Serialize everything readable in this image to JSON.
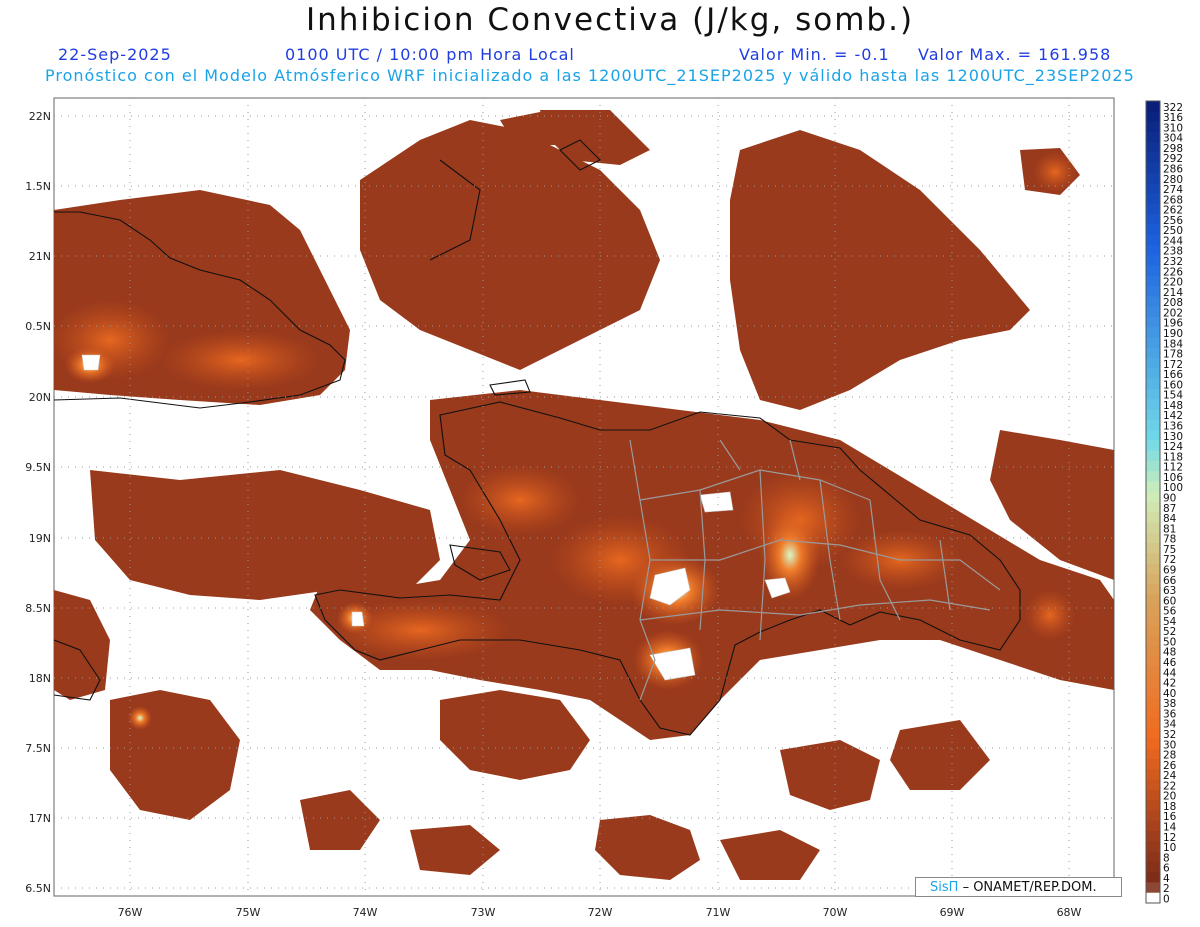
{
  "header": {
    "title": "Inhibicion Convectiva (J/kg, somb.)",
    "date": "22-Sep-2025",
    "time": "0100 UTC / 10:00 pm Hora Local",
    "min_label": "Valor Min. = -0.1",
    "max_label": "Valor Max. = 161.958",
    "forecast_line": "Pronóstico con el Modelo Atmósferico WRF inicializado a las 1200UTC_21SEP2025 y válido hasta las  1200UTC_23SEP2025"
  },
  "credit": {
    "logo_text": "SisΠ",
    "org_text": "– ONAMET/REP.DOM."
  },
  "map": {
    "lat_ticks": [
      "22N",
      "1.5N",
      "21N",
      "0.5N",
      "20N",
      "9.5N",
      "19N",
      "8.5N",
      "18N",
      "7.5N",
      "17N",
      "6.5N"
    ],
    "lon_ticks": [
      "76W",
      "75W",
      "74W",
      "73W",
      "72W",
      "71W",
      "70W",
      "69W",
      "68W"
    ],
    "regions": [
      "Cuba (oriente)",
      "Haití",
      "República Dominicana",
      "Jamaica",
      "Bahamas / Turks y Caicos"
    ]
  },
  "colorbar": {
    "labels": [
      "322",
      "316",
      "310",
      "304",
      "298",
      "292",
      "286",
      "280",
      "274",
      "268",
      "262",
      "256",
      "250",
      "244",
      "238",
      "232",
      "226",
      "220",
      "214",
      "208",
      "202",
      "196",
      "190",
      "184",
      "178",
      "172",
      "166",
      "160",
      "154",
      "148",
      "142",
      "136",
      "130",
      "124",
      "118",
      "112",
      "106",
      "100",
      "90",
      "87",
      "84",
      "81",
      "78",
      "75",
      "72",
      "69",
      "66",
      "63",
      "60",
      "56",
      "54",
      "52",
      "50",
      "48",
      "46",
      "44",
      "42",
      "40",
      "38",
      "36",
      "34",
      "32",
      "30",
      "28",
      "26",
      "24",
      "22",
      "20",
      "18",
      "16",
      "14",
      "12",
      "10",
      "8",
      "6",
      "4",
      "2",
      "0"
    ],
    "colors": {
      "navy": "#0a1f7a",
      "blue": "#1d63e0",
      "cyan": "#6fd8e8",
      "pale_green": "#cfeeb8",
      "tan": "#d9a35c",
      "orange": "#f06a1e",
      "brown": "#9a3a1c",
      "dark_brown": "#7a2a16",
      "zero": "#ffffff"
    }
  }
}
